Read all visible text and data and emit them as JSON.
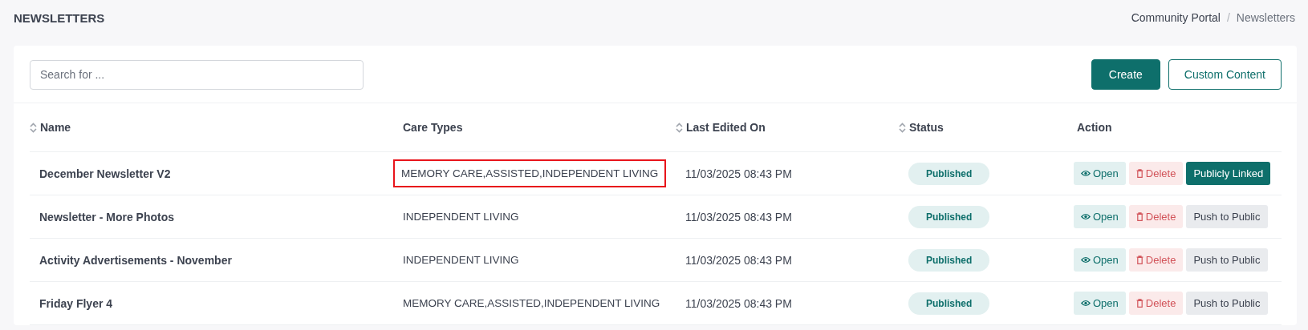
{
  "page_title": "NEWSLETTERS",
  "breadcrumb_separator": "/",
  "breadcrumb": [
    {
      "label": "Community Portal",
      "selected": false
    },
    {
      "label": "Newsletters",
      "selected": true
    }
  ],
  "search": {
    "placeholder": "Search for ..."
  },
  "buttons": [
    {
      "label": "Create",
      "kind": "primary"
    },
    {
      "label": "Custom Content",
      "kind": "outline"
    }
  ],
  "table": {
    "columns": [
      {
        "label": "Name",
        "sortable": true
      },
      {
        "label": "Care Types",
        "sortable": false
      },
      {
        "label": "Last Edited On",
        "sortable": true
      },
      {
        "label": "Status",
        "sortable": true
      },
      {
        "label": "Action",
        "sortable": false
      }
    ],
    "rows": [
      {
        "name": "December Newsletter V2",
        "care_types": "MEMORY CARE,ASSISTED,INDEPENDENT LIVING",
        "highlighted": true,
        "last_edited": "11/03/2025 08:43 PM",
        "status": "Published",
        "actions": [
          {
            "label": "Open",
            "kind": "open"
          },
          {
            "label": "Delete",
            "kind": "delete"
          },
          {
            "label": "Publicly Linked",
            "kind": "linked"
          }
        ]
      },
      {
        "name": "Newsletter - More Photos",
        "care_types": "INDEPENDENT LIVING",
        "highlighted": false,
        "last_edited": "11/03/2025 08:43 PM",
        "status": "Published",
        "actions": [
          {
            "label": "Open",
            "kind": "open"
          },
          {
            "label": "Delete",
            "kind": "delete"
          },
          {
            "label": "Push to Public",
            "kind": "push"
          }
        ]
      },
      {
        "name": "Activity Advertisements - November",
        "care_types": "INDEPENDENT LIVING",
        "highlighted": false,
        "last_edited": "11/03/2025 08:43 PM",
        "status": "Published",
        "actions": [
          {
            "label": "Open",
            "kind": "open"
          },
          {
            "label": "Delete",
            "kind": "delete"
          },
          {
            "label": "Push to Public",
            "kind": "push"
          }
        ]
      },
      {
        "name": "Friday Flyer 4",
        "care_types": "MEMORY CARE,ASSISTED,INDEPENDENT LIVING",
        "highlighted": false,
        "last_edited": "11/03/2025 08:43 PM",
        "status": "Published",
        "actions": [
          {
            "label": "Open",
            "kind": "open"
          },
          {
            "label": "Delete",
            "kind": "delete"
          },
          {
            "label": "Push to Public",
            "kind": "push"
          }
        ]
      }
    ]
  }
}
